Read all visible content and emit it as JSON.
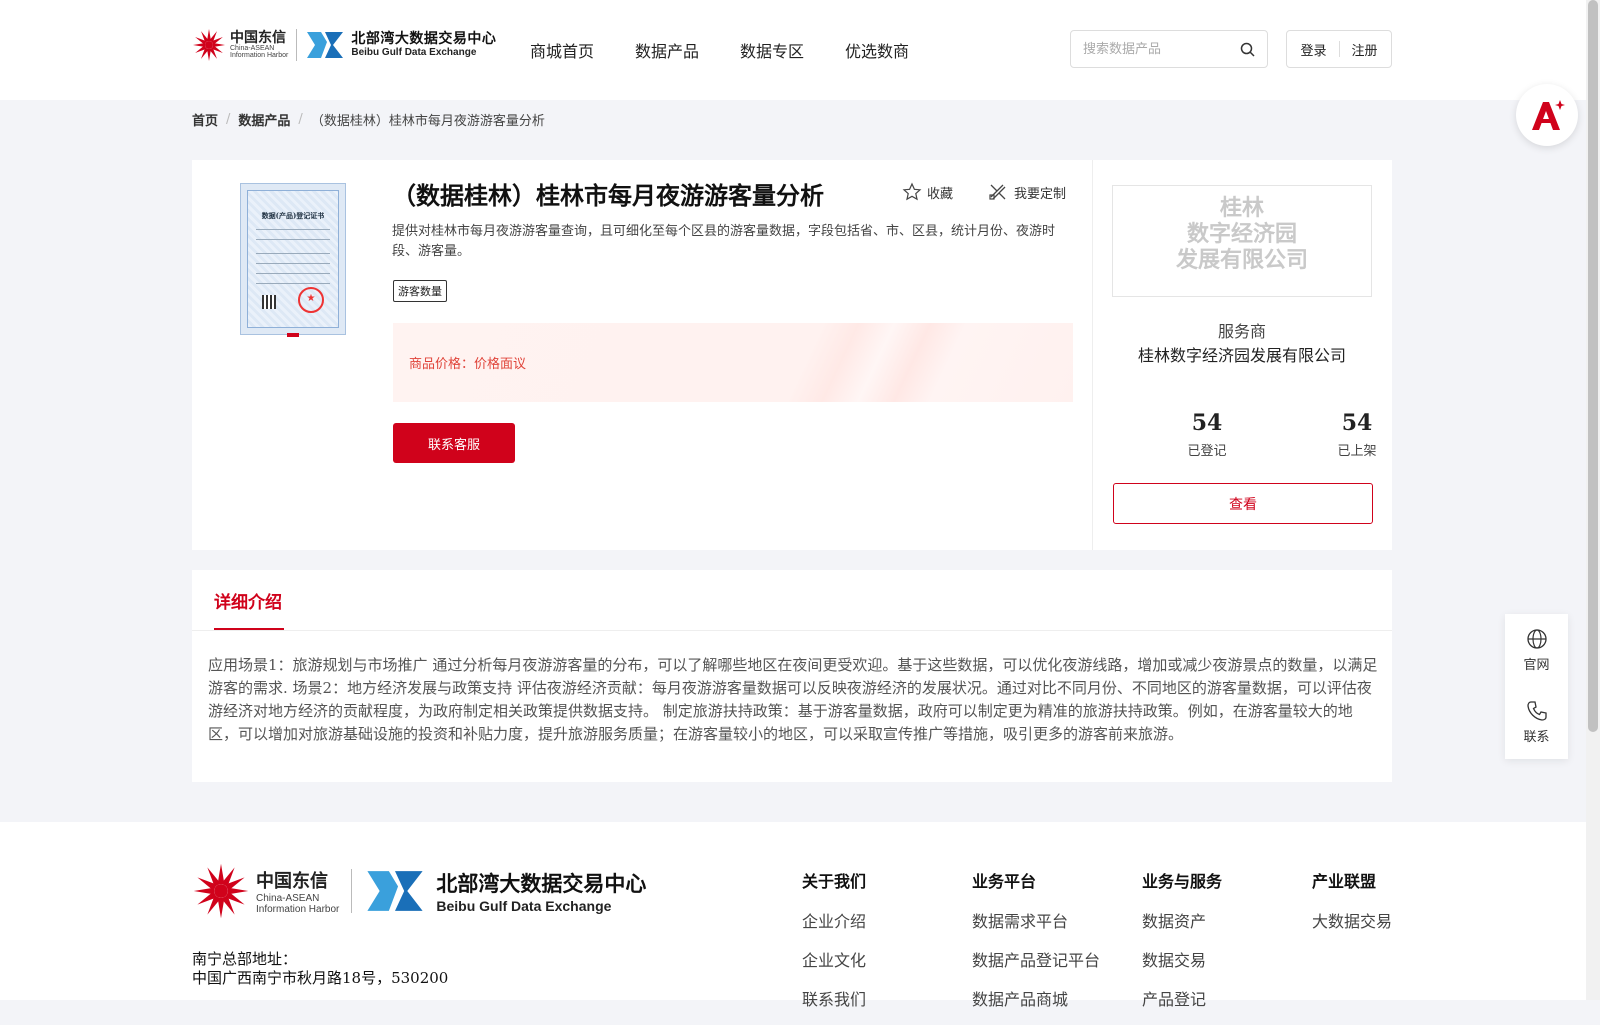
{
  "header": {
    "logo_cd_cn": "中国东信",
    "logo_cd_en1": "China-ASEAN",
    "logo_cd_en2": "Information Harbor",
    "logo_bb_cn": "北部湾大数据交易中心",
    "logo_bb_en": "Beibu Gulf Data Exchange",
    "nav": [
      "商城首页",
      "数据产品",
      "数据专区",
      "优选数商"
    ],
    "search_placeholder": "搜索数据产品",
    "login": "登录",
    "register": "注册"
  },
  "breadcrumb": [
    "首页",
    "数据产品",
    "（数据桂林）桂林市每月夜游游客量分析"
  ],
  "product": {
    "title": "（数据桂林）桂林市每月夜游游客量分析",
    "favorite": "收藏",
    "custom": "我要定制",
    "description": "提供对桂林市每月夜游游客量查询，且可细化至每个区县的游客量数据，字段包括省、市、区县，统计月份、夜游时段、游客量。",
    "tag": "游客数量",
    "price_label": "商品价格：",
    "price_value": "价格面议",
    "contact_button": "联系客服",
    "cert_title": "数据(产品)登记证书"
  },
  "provider": {
    "logo_lines": [
      "桂林",
      "数字经济园",
      "发展有限公司"
    ],
    "label": "服务商",
    "name": "桂林数字经济园发展有限公司",
    "registered_count": "54",
    "registered_label": "已登记",
    "listed_count": "54",
    "listed_label": "已上架",
    "view_button": "查看"
  },
  "detail": {
    "tab": "详细介绍",
    "text": "应用场景1：旅游规划与市场推广 通过分析每月夜游游客量的分布，可以了解哪些地区在夜间更受欢迎。基于这些数据，可以优化夜游线路，增加或减少夜游景点的数量，以满足游客的需求. 场景2：地方经济发展与政策支持 评估夜游经济贡献：每月夜游游客量数据可以反映夜游经济的发展状况。通过对比不同月份、不同地区的游客量数据，可以评估夜游经济对地方经济的贡献程度，为政府制定相关政策提供数据支持。 制定旅游扶持政策：基于游客量数据，政府可以制定更为精准的旅游扶持政策。例如，在游客量较大的地区，可以增加对旅游基础设施的投资和补贴力度，提升旅游服务质量；在游客量较小的地区，可以采取宣传推广等措施，吸引更多的游客前来旅游。"
  },
  "footer": {
    "address_label": "南宁总部地址：",
    "address": "中国广西南宁市秋月路18号，530200",
    "columns": [
      {
        "title": "关于我们",
        "items": [
          "企业介绍",
          "企业文化",
          "联系我们"
        ]
      },
      {
        "title": "业务平台",
        "items": [
          "数据需求平台",
          "数据产品登记平台",
          "数据产品商城"
        ]
      },
      {
        "title": "业务与服务",
        "items": [
          "数据资产",
          "数据交易",
          "产品登记"
        ]
      },
      {
        "title": "产业联盟",
        "items": [
          "大数据交易"
        ]
      }
    ]
  },
  "side": {
    "website": "官网",
    "contact": "联系"
  },
  "colors": {
    "brand_red": "#d0021b",
    "price_text": "#e0443a"
  }
}
